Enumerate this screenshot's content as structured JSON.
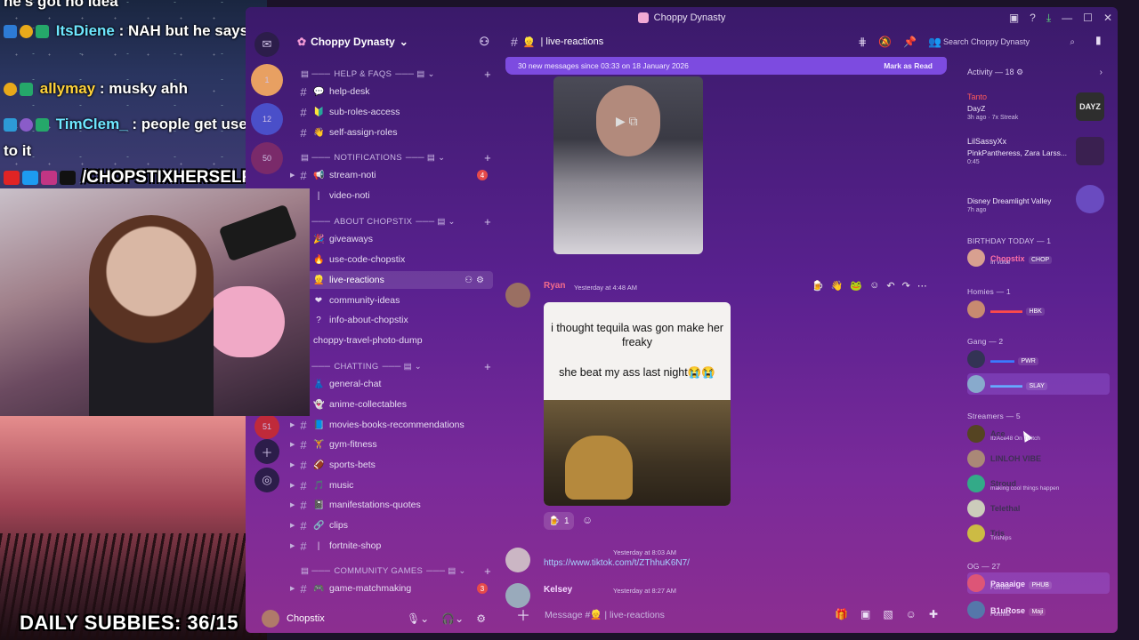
{
  "overlay": {
    "top_cut_text": "he's got no idea",
    "chat": [
      {
        "name": "ItsDiene",
        "text": " : NAH but he says guys scratch and sniff YUCK",
        "name_color": "#6ee7ff"
      },
      {
        "name": "allymay",
        "text": " : musky ahh",
        "name_color": "#ffd23a"
      },
      {
        "name": "TimClem_",
        "text": " : people get used to it",
        "name_color": "#6ee7ff"
      }
    ],
    "handle": "/CHOPSTIXHERSELF",
    "subbies": "DAILY SUBBIES: 36/15"
  },
  "window": {
    "title": "Choppy Dynasty",
    "controls": [
      "▣",
      "?",
      "⤓",
      "—",
      "☐",
      "✕"
    ]
  },
  "rail": {
    "badges": [
      "1",
      "12",
      "50",
      "51"
    ]
  },
  "server": {
    "name": "Choppy Dynasty",
    "categories": [
      {
        "label": "HELP & FAQS"
      },
      {
        "label": "NOTIFICATIONS"
      },
      {
        "label": "ABOUT CHOPSTIX"
      },
      {
        "label": "CHATTING"
      },
      {
        "label": "COMMUNITY GAMES"
      }
    ],
    "channels": [
      {
        "name": "help-desk",
        "emoji": "💬"
      },
      {
        "name": "sub-roles-access",
        "emoji": "🔰"
      },
      {
        "name": "self-assign-roles",
        "emoji": "👋"
      },
      {
        "name": "stream-noti",
        "emoji": "📢",
        "count": "4"
      },
      {
        "name": "video-noti",
        "emoji": "|"
      },
      {
        "name": "giveaways",
        "emoji": "🎉"
      },
      {
        "name": "use-code-chopstix",
        "emoji": "🔥"
      },
      {
        "name": "live-reactions",
        "emoji": "👱"
      },
      {
        "name": "community-ideas",
        "emoji": "❤"
      },
      {
        "name": "info-about-chopstix",
        "emoji": "?"
      },
      {
        "name": "choppy-travel-photo-dump",
        "emoji": ""
      },
      {
        "name": "general-chat",
        "emoji": "👗"
      },
      {
        "name": "anime-collectables",
        "emoji": "👻"
      },
      {
        "name": "movies-books-recommendations",
        "emoji": "📘"
      },
      {
        "name": "gym-fitness",
        "emoji": "🏋"
      },
      {
        "name": "sports-bets",
        "emoji": "🏈"
      },
      {
        "name": "music",
        "emoji": "🎵"
      },
      {
        "name": "manifestations-quotes",
        "emoji": "📓"
      },
      {
        "name": "clips",
        "emoji": "🔗"
      },
      {
        "name": "fortnite-shop",
        "emoji": "|"
      },
      {
        "name": "game-matchmaking",
        "emoji": "🎮",
        "count": "3"
      }
    ],
    "user": "Chopstix"
  },
  "chat": {
    "channel": "live-reactions",
    "new_messages": "30 new messages since 03:33 on 18 January 2026",
    "mark_read": "Mark as Read",
    "messages": [
      {
        "author": "Ryan",
        "time": "Yesterday at 4:48 AM",
        "color": "#f46b8b"
      },
      {
        "author": "",
        "time": "Yesterday at 8:03 AM",
        "color": "#c06bff",
        "link": "https://www.tiktok.com/t/ZThhuK6N7/"
      },
      {
        "author": "Kelsey",
        "time": "Yesterday at 8:27 AM",
        "color": "#f5d9ff"
      }
    ],
    "meme_text_top": "i thought tequila was gon make her freaky",
    "meme_text_bottom": "she beat my ass last night😭😭",
    "reaction_count": "1",
    "composer_placeholder": "Message #👱 | live-reactions"
  },
  "search": {
    "placeholder": "Search Choppy Dynasty"
  },
  "members": {
    "activity_header": "Activity — 18",
    "activities": [
      {
        "user": "Tanto",
        "game": "DayZ",
        "meta": "3h ago · 7x Streak",
        "art": "#2e2e2e",
        "art_text": "DAYZ"
      },
      {
        "user": "LilSassyXx",
        "game": "PinkPantheress, Zara Larss...",
        "meta": "0:45",
        "art": "#3a2050",
        "art_text": ""
      },
      {
        "user": "",
        "game": "Disney Dreamlight Valley",
        "meta": "7h ago",
        "art": "#6a4bc0",
        "art_text": ""
      }
    ],
    "groups": [
      {
        "label": "BIRTHDAY TODAY — 1"
      },
      {
        "label": "Homies — 1"
      },
      {
        "label": "Gang — 2"
      },
      {
        "label": "Streamers — 5"
      },
      {
        "label": "OG — 27"
      }
    ],
    "list": [
      {
        "name": "Chopstix",
        "tag": "CHOP",
        "sub": "In voice",
        "color": "#ff6fa6",
        "av": "#d8a090"
      },
      {
        "name": "",
        "tag": "HBK",
        "sub": "",
        "color": "#ff4a4a",
        "av": "#c88a70"
      },
      {
        "name": "",
        "tag": "PWR",
        "sub": "",
        "color": "#3a7aff",
        "av": "#335"
      },
      {
        "name": "",
        "tag": "SLAY",
        "sub": "",
        "color": "#66aaff",
        "av": "#8ac"
      },
      {
        "name": "Ace",
        "tag": "",
        "sub": "ItzAce48 On Twitch",
        "color": "#3f2f55",
        "av": "#542"
      },
      {
        "name": "LINLOH VIBE",
        "tag": "",
        "sub": "",
        "color": "#3f2f55",
        "av": "#a87"
      },
      {
        "name": "Stroud",
        "tag": "",
        "sub": "making cool things happen",
        "color": "#3f2f55",
        "av": "#3a8"
      },
      {
        "name": "Telethal",
        "tag": "",
        "sub": "",
        "color": "#3f2f55",
        "av": "#ccb"
      },
      {
        "name": "Tris",
        "tag": "",
        "sub": "TrisNips",
        "color": "#3f2f55",
        "av": "#cb4"
      },
      {
        "name": "Paaaaige",
        "tag": "PHUB",
        "sub": "Fortnite",
        "color": "#f6e0ff",
        "av": "#d57"
      },
      {
        "name": "B1uRose",
        "tag": "Maji",
        "sub": "Fortnite",
        "color": "#f6e0ff",
        "av": "#57a"
      }
    ]
  }
}
